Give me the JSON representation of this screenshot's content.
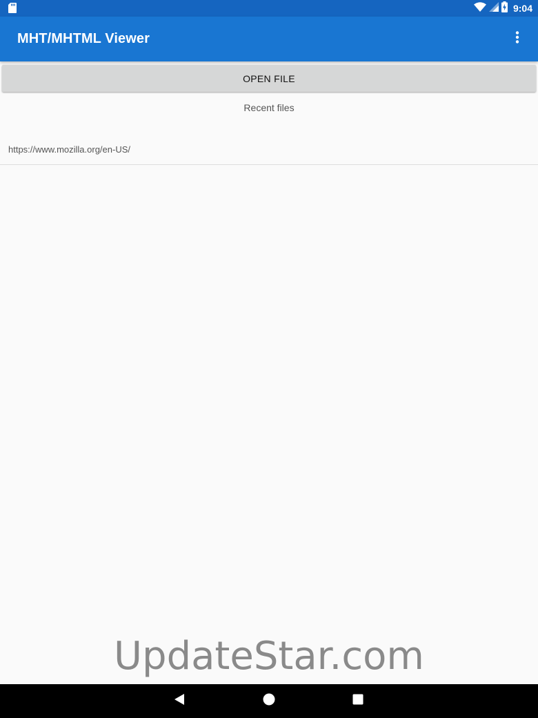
{
  "status_bar": {
    "time": "9:04",
    "icons": [
      "sd-card-icon",
      "wifi-icon",
      "signal-icon",
      "battery-charging-icon"
    ]
  },
  "app_bar": {
    "title": "MHT/MHTML Viewer",
    "menu_icon": "more-vert-icon"
  },
  "main": {
    "open_button_label": "OPEN FILE",
    "recent_label": "Recent files",
    "recent_files": [
      "https://www.mozilla.org/en-US/"
    ]
  },
  "watermark": "UpdateStar.com",
  "nav_bar": {
    "icons": [
      "back-icon",
      "home-icon",
      "recents-icon"
    ]
  },
  "colors": {
    "status_bar": "#1565c0",
    "app_bar": "#1976d2",
    "background": "#fafafa",
    "button": "#d6d7d7"
  }
}
